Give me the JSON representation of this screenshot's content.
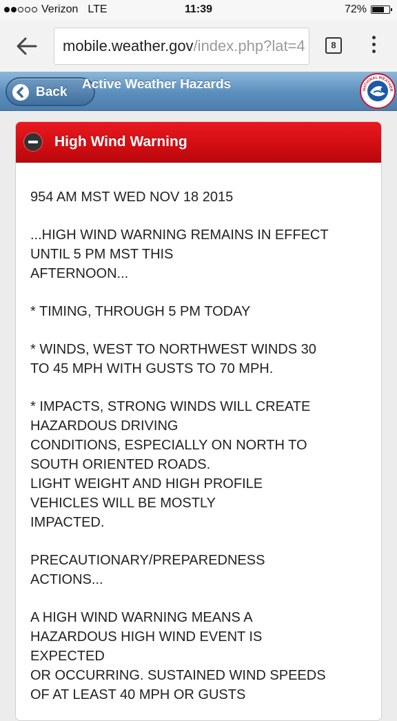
{
  "status_bar": {
    "carrier": "Verizon",
    "network": "LTE",
    "time": "11:39",
    "battery_percent": "72%",
    "battery_level": 0.72,
    "signal_bars": 2,
    "signal_total": 5
  },
  "browser": {
    "url_host": "mobile.weather.gov",
    "url_path": "/index.php?lat=4",
    "tab_count": "8",
    "icons": {
      "back": "arrow-left-icon",
      "tabs": "tabs-icon",
      "menu": "more-vert-icon"
    }
  },
  "header": {
    "back_label": "Back",
    "title": "Active Weather Hazards",
    "logo_text": "NATIONAL WEATHER SERVICE"
  },
  "hazard": {
    "title": "High Wind Warning",
    "paragraphs": [
      [
        "954 AM MST WED NOV 18 2015"
      ],
      [
        "...HIGH WIND WARNING REMAINS IN EFFECT",
        "UNTIL 5 PM MST THIS",
        "AFTERNOON..."
      ],
      [
        "* TIMING, THROUGH 5 PM TODAY"
      ],
      [
        "* WINDS, WEST TO NORTHWEST WINDS 30",
        "TO 45 MPH WITH GUSTS TO 70 MPH."
      ],
      [
        "* IMPACTS, STRONG WINDS WILL CREATE",
        "HAZARDOUS DRIVING",
        "CONDITIONS, ESPECIALLY ON NORTH TO",
        "SOUTH ORIENTED ROADS.",
        "LIGHT WEIGHT AND HIGH PROFILE",
        "VEHICLES WILL BE MOSTLY",
        "IMPACTED."
      ],
      [
        "PRECAUTIONARY/PREPAREDNESS",
        "ACTIONS..."
      ],
      [
        "A HIGH WIND WARNING MEANS A",
        "HAZARDOUS HIGH WIND EVENT IS",
        "EXPECTED",
        "OR OCCURRING. SUSTAINED WIND SPEEDS",
        "OF AT LEAST 40 MPH OR GUSTS"
      ]
    ]
  },
  "colors": {
    "warning_red": "#d10d12",
    "header_blue": "#5b8fbc",
    "card_bg": "#ffffff"
  }
}
